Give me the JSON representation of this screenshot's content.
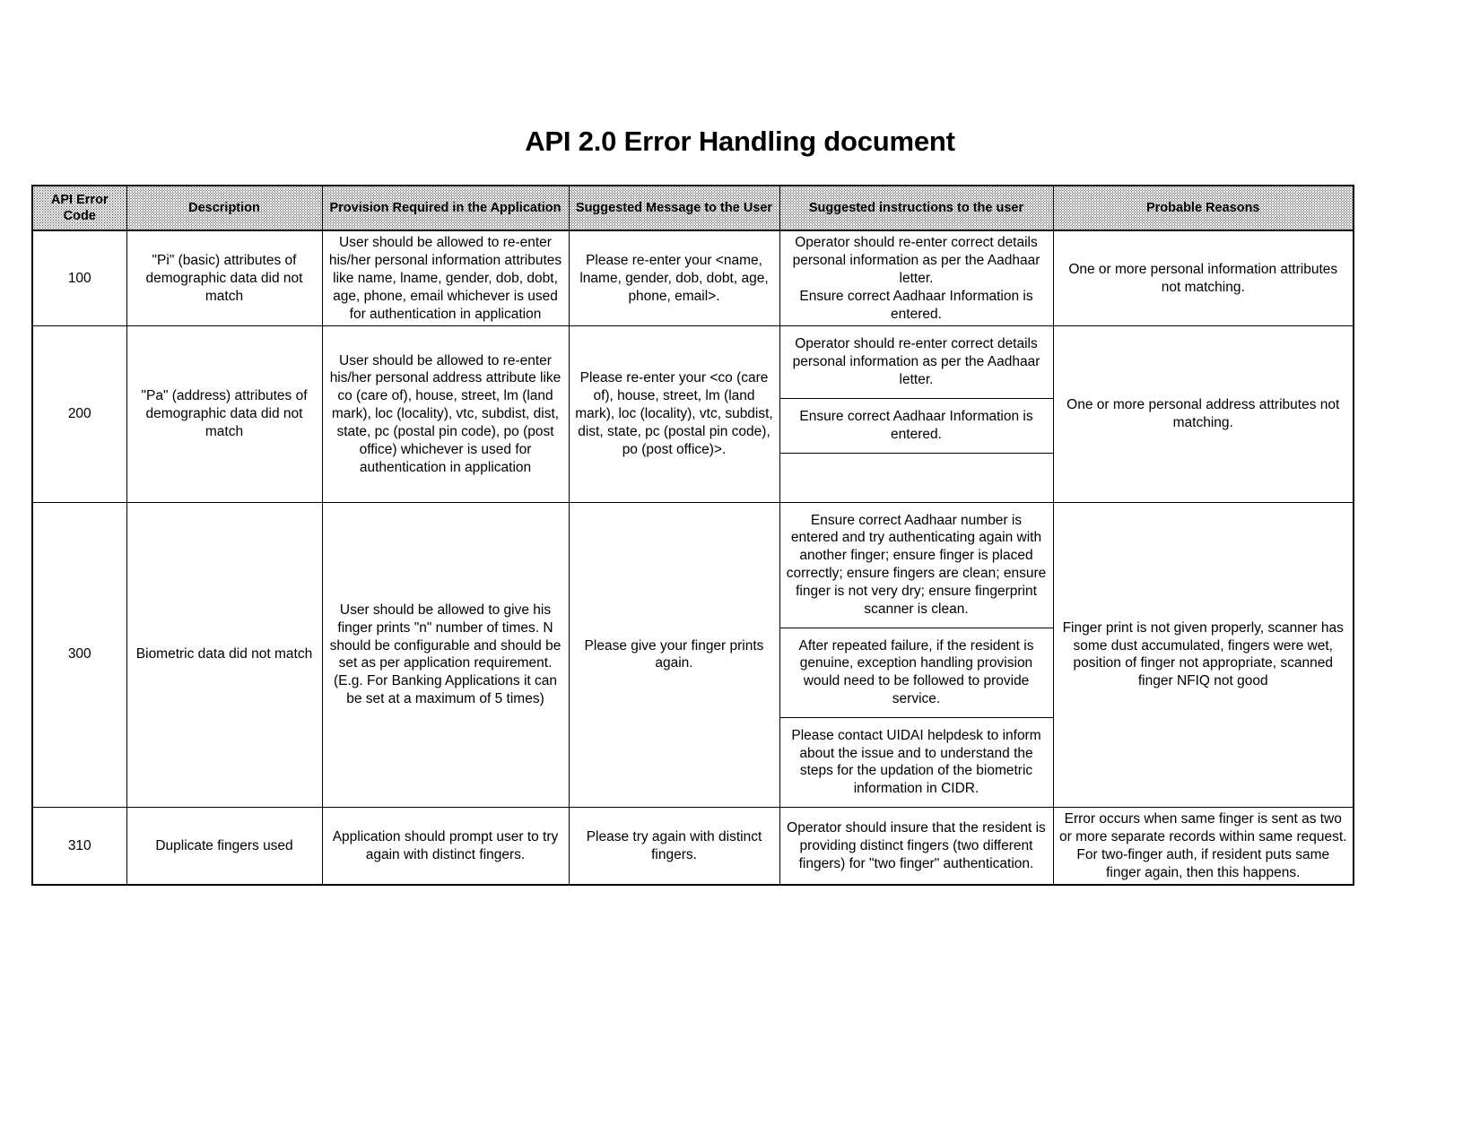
{
  "document": {
    "title": "API 2.0 Error Handling document"
  },
  "table": {
    "headers": [
      "API Error Code",
      "Description",
      "Provision Required in the Application",
      "Suggested Message to the User",
      "Suggested instructions to the user",
      "Probable Reasons"
    ],
    "rows": [
      {
        "code": "100",
        "description": "\"Pi\" (basic) attributes of demographic data did not match",
        "provision": "User should be allowed to re-enter his/her personal information attributes like name, lname, gender, dob, dobt, age, phone, email whichever is used for authentication in application",
        "message": "Please re-enter your <name, lname, gender, dob, dobt, age, phone, email>.",
        "instructions": [
          "Operator should re-enter correct details personal information as per the Aadhaar letter.\nEnsure correct Aadhaar Information is entered."
        ],
        "reason": "One or more personal information attributes not matching."
      },
      {
        "code": "200",
        "description": "\"Pa\" (address) attributes of demographic data did not match",
        "provision": "User should be allowed to re-enter his/her personal address attribute like co (care of), house, street, lm (land mark), loc (locality), vtc, subdist, dist, state, pc (postal pin code), po (post office) whichever is used for authentication in application",
        "message": "Please re-enter your <co (care of), house, street, lm (land mark), loc (locality), vtc, subdist, dist, state, pc (postal pin code), po (post office)>.",
        "instructions": [
          "Operator should re-enter correct details personal information as per the Aadhaar letter.",
          "Ensure correct Aadhaar Information is entered.",
          ""
        ],
        "reason": "One or more personal address attributes not matching."
      },
      {
        "code": "300",
        "description": "Biometric data did not match",
        "provision": "User should be allowed to give his finger prints \"n\" number of times. N should be configurable and should be set as per application requirement. (E.g. For Banking Applications it can be set at a maximum of 5 times)",
        "message": "Please give your finger prints again.",
        "instructions": [
          "Ensure correct Aadhaar number is entered and try authenticating again with another finger; ensure finger is placed correctly; ensure fingers are clean; ensure finger is not very dry; ensure fingerprint scanner is clean.",
          "After repeated failure, if the resident is genuine, exception handling provision would need to be followed to provide service.",
          "Please contact UIDAI helpdesk to inform about the issue and to understand the steps for the updation of the biometric information in CIDR."
        ],
        "reason": "Finger print is not given properly, scanner has some dust accumulated, fingers were wet, position of finger not appropriate, scanned finger NFIQ not good"
      },
      {
        "code": "310",
        "description": "Duplicate fingers used",
        "provision": "Application should prompt user to try again with distinct fingers.",
        "message": "Please try again with distinct fingers.",
        "instructions": [
          "Operator should insure that the resident is providing distinct fingers (two different fingers) for \"two finger\" authentication."
        ],
        "reason": "Error occurs when same finger is sent as two or more separate records within same request. For two-finger auth, if resident puts same finger again, then this happens."
      }
    ]
  }
}
